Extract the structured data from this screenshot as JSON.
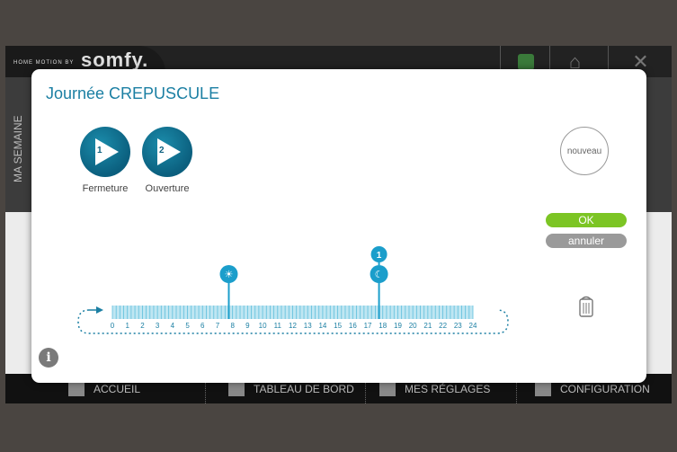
{
  "header": {
    "brand_small": "HOME MOTION BY",
    "brand": "somfy."
  },
  "side_label": "MA SEMAINE",
  "footer": {
    "items": [
      {
        "label": "ACCUEIL",
        "icon": "home-icon"
      },
      {
        "label": "TABLEAU DE BORD",
        "icon": "dashboard-icon"
      },
      {
        "label": "MES RÉGLAGES",
        "icon": "user-icon"
      },
      {
        "label": "CONFIGURATION",
        "icon": "gear-icon"
      }
    ]
  },
  "modal": {
    "title": "Journée CREPUSCULE",
    "scenarios": [
      {
        "number": "1",
        "label": "Fermeture"
      },
      {
        "number": "2",
        "label": "Ouverture"
      }
    ],
    "new_button": "nouveau",
    "ok_label": "OK",
    "cancel_label": "annuler",
    "timeline": {
      "hours": [
        "0",
        "1",
        "2",
        "3",
        "4",
        "5",
        "6",
        "7",
        "8",
        "9",
        "10",
        "11",
        "12",
        "13",
        "14",
        "15",
        "16",
        "17",
        "18",
        "19",
        "20",
        "21",
        "22",
        "23",
        "24"
      ],
      "markers": [
        {
          "hour": 7.75,
          "type": "sunrise",
          "icon": "sunrise-icon"
        },
        {
          "hour": 17.75,
          "type": "sunset",
          "icon": "moon-icon",
          "scenario": "1"
        }
      ]
    }
  },
  "colors": {
    "accent": "#1b7fa3",
    "ok": "#7cc524",
    "cancel": "#9a9a9a",
    "bar": "#bfe6f2"
  }
}
